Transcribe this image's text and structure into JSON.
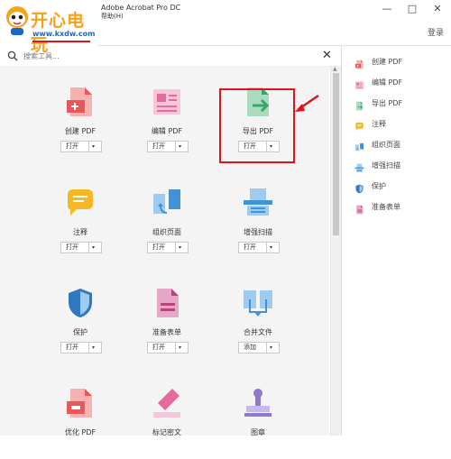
{
  "window": {
    "title": "Adobe Acrobat Pro DC",
    "menu_help": "帮助(H)",
    "login": "登录"
  },
  "watermark": {
    "name": "开心电玩",
    "url": "www.kxdw.com"
  },
  "search": {
    "placeholder": "搜索工具..."
  },
  "tools": [
    {
      "label": "创建 PDF",
      "action": "打开",
      "icon": "create-pdf-icon"
    },
    {
      "label": "编辑 PDF",
      "action": "打开",
      "icon": "edit-pdf-icon"
    },
    {
      "label": "导出 PDF",
      "action": "打开",
      "icon": "export-pdf-icon"
    },
    {
      "label": "注释",
      "action": "打开",
      "icon": "comment-icon"
    },
    {
      "label": "组织页面",
      "action": "打开",
      "icon": "organize-pages-icon"
    },
    {
      "label": "增强扫描",
      "action": "打开",
      "icon": "enhance-scan-icon"
    },
    {
      "label": "保护",
      "action": "打开",
      "icon": "protect-icon"
    },
    {
      "label": "准备表单",
      "action": "打开",
      "icon": "prepare-form-icon"
    },
    {
      "label": "合并文件",
      "action": "添加",
      "icon": "combine-files-icon"
    },
    {
      "label": "优化 PDF",
      "action": "",
      "icon": "optimize-pdf-icon"
    },
    {
      "label": "标记密文",
      "action": "",
      "icon": "redact-icon"
    },
    {
      "label": "图章",
      "action": "",
      "icon": "stamp-icon"
    }
  ],
  "right_panel": [
    {
      "label": "创建 PDF",
      "icon": "create-pdf-icon",
      "color": "#e8585a"
    },
    {
      "label": "编辑 PDF",
      "icon": "edit-pdf-icon",
      "color": "#e56b9c"
    },
    {
      "label": "导出 PDF",
      "icon": "export-pdf-icon",
      "color": "#3aa36a"
    },
    {
      "label": "注释",
      "icon": "comment-icon",
      "color": "#f5b824"
    },
    {
      "label": "组织页面",
      "icon": "organize-pages-icon",
      "color": "#3f93d6"
    },
    {
      "label": "增强扫描",
      "icon": "enhance-scan-icon",
      "color": "#3f93d6"
    },
    {
      "label": "保护",
      "icon": "protect-icon",
      "color": "#2f79c0"
    },
    {
      "label": "准备表单",
      "icon": "prepare-form-icon",
      "color": "#b7457c"
    }
  ]
}
